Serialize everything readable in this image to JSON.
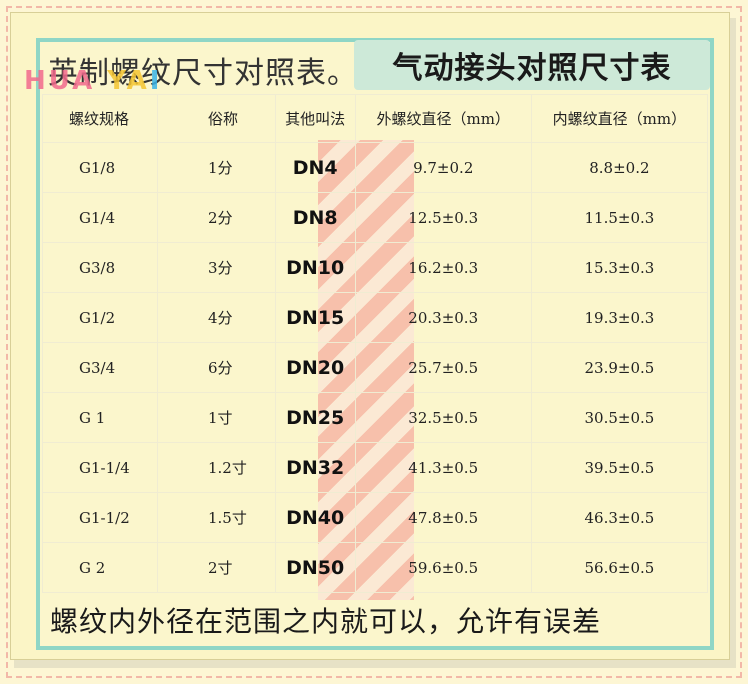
{
  "title_left": "英制螺纹尺寸对照表。",
  "title_right": "气动接头对照尺寸表",
  "watermark": {
    "part1": "HUA",
    "part2": " YA",
    "part3": "I"
  },
  "table": {
    "headers": [
      "螺纹规格",
      "俗称",
      "其他叫法",
      "外螺纹直径（mm）",
      "内螺纹直径（mm）"
    ],
    "rows": [
      [
        "G1/8",
        "1分",
        "DN4",
        "9.7±0.2",
        "8.8±0.2"
      ],
      [
        "G1/4",
        "2分",
        "DN8",
        "12.5±0.3",
        "11.5±0.3"
      ],
      [
        "G3/8",
        "3分",
        "DN10",
        "16.2±0.3",
        "15.3±0.3"
      ],
      [
        "G1/2",
        "4分",
        "DN15",
        "20.3±0.3",
        "19.3±0.3"
      ],
      [
        "G3/4",
        "6分",
        "DN20",
        "25.7±0.5",
        "23.9±0.5"
      ],
      [
        "G 1",
        "1寸",
        "DN25",
        "32.5±0.5",
        "30.5±0.5"
      ],
      [
        "G1-1/4",
        "1.2寸",
        "DN32",
        "41.3±0.5",
        "39.5±0.5"
      ],
      [
        "G1-1/2",
        "1.5寸",
        "DN40",
        "47.8±0.5",
        "46.3±0.5"
      ],
      [
        "G 2",
        "2寸",
        "DN50",
        "59.6±0.5",
        "56.6±0.5"
      ]
    ]
  },
  "footer": "螺纹内外径在范围之内就可以，允许有误差",
  "colors": {
    "accent_border": "#8fd6c6",
    "title_box": "#cde9d8",
    "stripe": "#f6b7a5",
    "background": "#fdf6d4"
  }
}
